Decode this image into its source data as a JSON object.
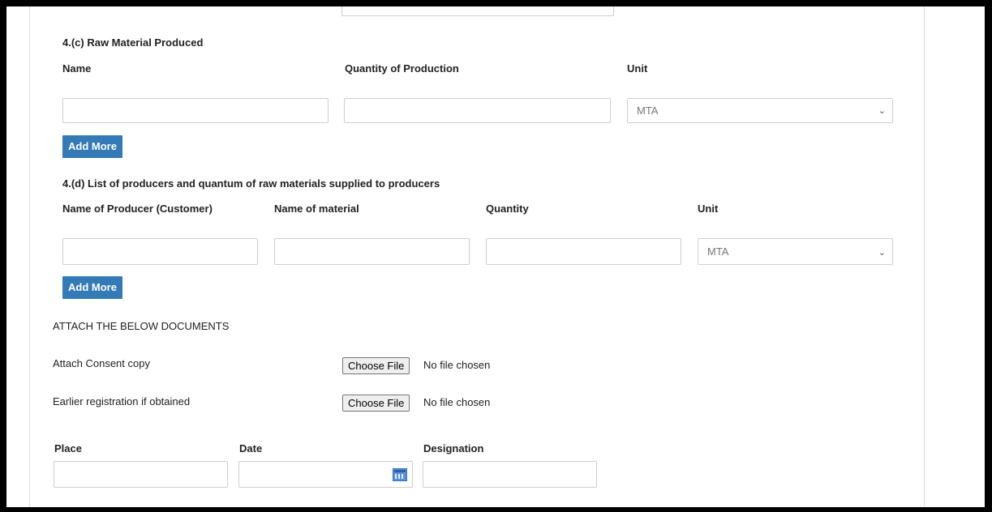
{
  "section_c": {
    "heading": "4.(c) Raw Material Produced",
    "col_name": "Name",
    "col_quantity": "Quantity of Production",
    "col_unit": "Unit",
    "unit_value": "MTA",
    "add_more": "Add More"
  },
  "section_d": {
    "heading": "4.(d) List of producers and quantum of raw materials supplied to producers",
    "col_producer": "Name of Producer (Customer)",
    "col_material": "Name of material",
    "col_quantity": "Quantity",
    "col_unit": "Unit",
    "unit_value": "MTA",
    "add_more": "Add More"
  },
  "attachments": {
    "heading": "ATTACH THE BELOW DOCUMENTS",
    "consent_label": "Attach Consent copy",
    "earlier_label": "Earlier registration if obtained",
    "choose_file": "Choose File",
    "no_file": "No file chosen"
  },
  "footer": {
    "place_label": "Place",
    "date_label": "Date",
    "designation_label": "Designation"
  },
  "colors": {
    "accent": "#337ab7"
  },
  "icons": {
    "calendar": "calendar-icon",
    "dropdown": "chevron-down-icon"
  }
}
